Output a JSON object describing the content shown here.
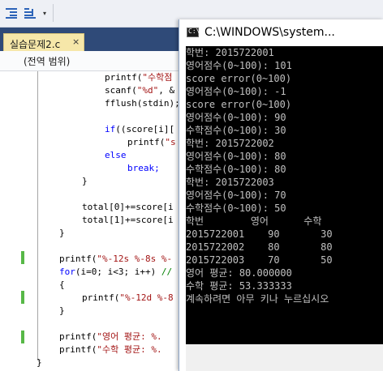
{
  "toolbar": {
    "indent_icon": "indent-icon",
    "outdent_icon": "outdent-icon",
    "dropdown_icon": "chevron-down-icon"
  },
  "tab": {
    "label": "실습문제2.c",
    "close_glyph": "×"
  },
  "scope_bar": {
    "label": "(전역 범위)"
  },
  "code_lines": [
    {
      "text": "printf(\"수학점",
      "kind": "str_call"
    },
    {
      "text": "scanf(\"%d\", &",
      "kind": "str_call"
    },
    {
      "text": "fflush(stdin);",
      "kind": "plain"
    },
    {
      "text": "",
      "kind": "plain"
    },
    {
      "text": "if((score[i][",
      "kind": "kw"
    },
    {
      "text": "printf(\"s",
      "kind": "str_call"
    },
    {
      "text": "else",
      "kind": "kw"
    },
    {
      "text": "break;",
      "kind": "kw"
    },
    {
      "text": "}",
      "kind": "plain"
    },
    {
      "text": "",
      "kind": "plain"
    },
    {
      "text": "total[0]+=score[i",
      "kind": "plain"
    },
    {
      "text": "total[1]+=score[i",
      "kind": "plain"
    },
    {
      "text": "}",
      "kind": "plain"
    },
    {
      "text": "",
      "kind": "plain"
    },
    {
      "text": "printf(\"%-12s %-8s %-",
      "kind": "str_call"
    },
    {
      "text": "for(i=0; i<3; i++) //",
      "kind": "for"
    },
    {
      "text": "{",
      "kind": "plain"
    },
    {
      "text": "printf(\"%-12d %-8",
      "kind": "str_call"
    },
    {
      "text": "}",
      "kind": "plain"
    },
    {
      "text": "",
      "kind": "plain"
    },
    {
      "text": "printf(\"영어 평균: %.",
      "kind": "str_call"
    },
    {
      "text": "printf(\"수학 평균: %.",
      "kind": "str_call"
    },
    {
      "text": "}",
      "kind": "plain"
    }
  ],
  "console": {
    "icon_text": "C:\\",
    "title": "C:\\WINDOWS\\system...",
    "lines": [
      "학번: 2015722001",
      "영어점수(0~100): 101",
      "score error(0~100)",
      "영어점수(0~100): -1",
      "score error(0~100)",
      "영어점수(0~100): 90",
      "수학점수(0~100): 30",
      "학번: 2015722002",
      "영어점수(0~100): 80",
      "수학점수(0~100): 80",
      "학번: 2015722003",
      "영어점수(0~100): 70",
      "수학점수(0~100): 50",
      "학번        영어      수학",
      "2015722001    90       30",
      "2015722002    80       80",
      "2015722003    70       50",
      "영어 평균: 80.000000",
      "수학 평균: 53.333333",
      "계속하려면 아무 키나 누르십시오"
    ]
  }
}
